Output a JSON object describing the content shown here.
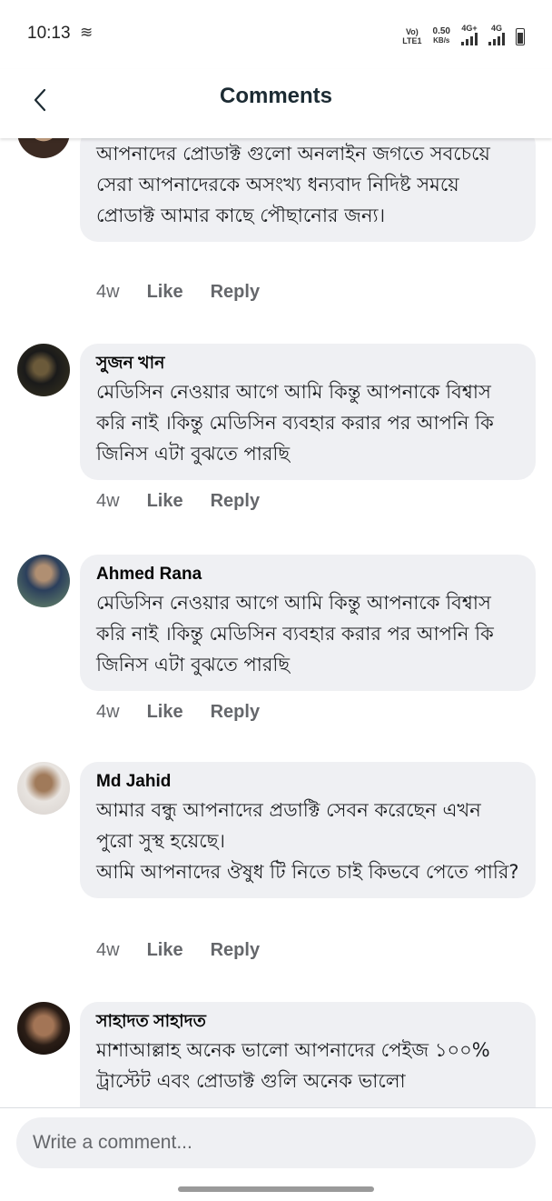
{
  "status_bar": {
    "time": "10:13",
    "time_icon": "≋",
    "volte_top": "Vo)",
    "volte_bottom": "LTE1",
    "speed_value": "0.50",
    "speed_unit": "KB/s",
    "net1": "4G+",
    "net2": "4G"
  },
  "header": {
    "title": "Comments",
    "back_icon": "chevron-left-icon"
  },
  "comments": [
    {
      "author": "",
      "text": "আপনাদের প্রোডাক্ট গুলো অনলাইন জগতে সবচেয়ে সেরা আপনাদেরকে অসংখ্য ধন্যবাদ নিদিষ্ট সময়ে প্রোডাক্ট আমার কাছে পৌছানোর জন্য।",
      "time": "4w",
      "like": "Like",
      "reply": "Reply"
    },
    {
      "author": "সুজন খান",
      "text": "মেডিসিন নেওয়ার আগে আমি কিন্তু আপনাকে বিশ্বাস করি নাই ।কিন্তু মেডিসিন ব্যবহার করার পর আপনি কি জিনিস এটা বুঝতে পারছি",
      "time": "4w",
      "like": "Like",
      "reply": "Reply"
    },
    {
      "author": "Ahmed Rana",
      "text": "মেডিসিন নেওয়ার আগে আমি কিন্তু আপনাকে বিশ্বাস করি নাই ।কিন্তু মেডিসিন ব্যবহার করার পর আপনি কি জিনিস এটা বুঝতে পারছি",
      "time": "4w",
      "like": "Like",
      "reply": "Reply"
    },
    {
      "author": "Md Jahid",
      "text": "আমার বন্ধু আপনাদের প্রডাক্টি সেবন করেছেন এখন পুরো সুস্থ হয়েছে।\nআমি আপনাদের ঔষুধ টি নিতে চাই কিভবে পেতে পারি?",
      "time": "4w",
      "like": "Like",
      "reply": "Reply"
    },
    {
      "author": "সাহাদত সাহাদত",
      "text": "মাশাআল্লাহ অনেক ভালো আপনাদের পেইজ ১০০% ট্রাস্টেট এবং প্রোডাক্ট গুলি অনেক ভালো",
      "time": "",
      "like": "",
      "reply": ""
    }
  ],
  "composer": {
    "placeholder": "Write a comment..."
  },
  "colors": {
    "bubble": "#eff0f3",
    "meta": "#65676b",
    "title": "#1c2b33"
  }
}
